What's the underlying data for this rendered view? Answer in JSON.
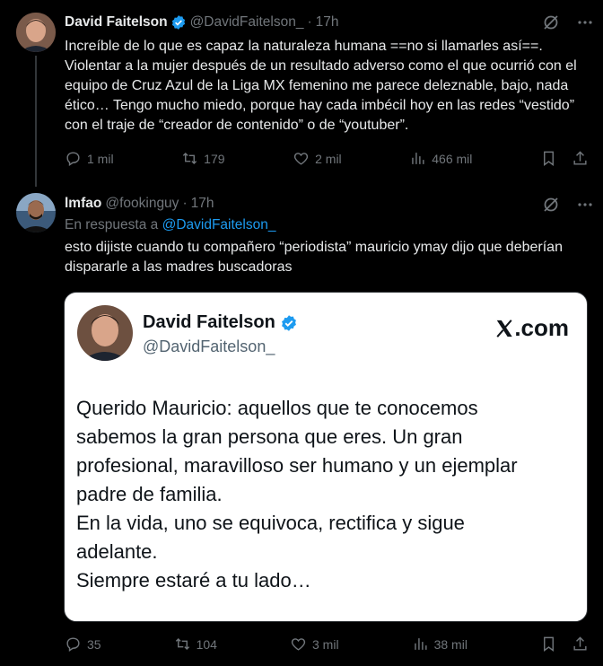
{
  "tweet1": {
    "name": "David Faitelson",
    "handle": "@DavidFaitelson_",
    "time": "17h",
    "text": "Increíble de lo que es capaz la naturaleza humana ==no si llamarles así==. Violentar a la mujer después de un resultado adverso como el que ocurrió con el equipo de Cruz Azul de la Liga MX femenino me parece deleznable, bajo, nada ético… Tengo mucho miedo, porque hay cada imbécil hoy en las redes “vestido” con el traje de  “creador de contenido” o de “youtuber”.",
    "replies": "1 mil",
    "retweets": "179",
    "likes": "2 mil",
    "views": "466 mil"
  },
  "tweet2": {
    "name": "lmfao",
    "handle": "@fookinguy",
    "time": "17h",
    "reply_prefix": "En respuesta a",
    "reply_to": "@DavidFaitelson_",
    "text": "esto dijiste cuando tu compañero “periodista” mauricio ymay dijo que deberían dispararle a las madres buscadoras",
    "replies": "35",
    "retweets": "104",
    "likes": "3 mil",
    "views": "38 mil"
  },
  "card": {
    "name": "David Faitelson",
    "handle": "@DavidFaitelson_",
    "logo_suffix": ".com",
    "line1": "Querido Mauricio: aquellos que te conocemos",
    "line2": "sabemos la gran persona que eres. Un gran",
    "line3": "profesional, maravilloso ser humano y un ejemplar",
    "line4": "padre de familia.",
    "line5": "En la vida, uno se equivoca, rectifica y sigue",
    "line6": "adelante.",
    "line7": "Siempre estaré a tu lado…"
  },
  "colors": {
    "background": "#000000",
    "text": "#e7e9ea",
    "muted": "#71767b",
    "link": "#1d9bf0",
    "verified": "#1d9bf0"
  },
  "icons": [
    "verified-badge-icon",
    "grok-icon",
    "more-icon",
    "reply-icon",
    "retweet-icon",
    "like-icon",
    "views-icon",
    "bookmark-icon",
    "share-icon",
    "x-logo-icon"
  ]
}
